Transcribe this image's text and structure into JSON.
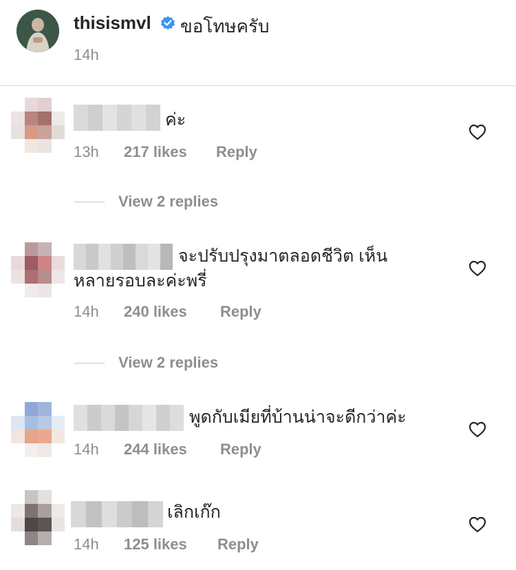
{
  "post": {
    "username": "thisismvl",
    "caption": "ขอโทษครับ",
    "time": "14h"
  },
  "comments": [
    {
      "text": "ค่ะ",
      "time": "13h",
      "likes": "217 likes",
      "reply": "Reply",
      "view_replies": "View 2 replies"
    },
    {
      "text": "จะปรับปรุงมาตลอดชีวิต เห็น\nหลายรอบละค่ะพรี่",
      "time": "14h",
      "likes": "240 likes",
      "reply": "Reply",
      "view_replies": "View 2 replies"
    },
    {
      "text": "พูดกับเมียที่บ้านน่าจะดีกว่าค่ะ",
      "time": "14h",
      "likes": "244 likes",
      "reply": "Reply"
    },
    {
      "text": "เลิกเก๊ก",
      "time": "14h",
      "likes": "125 likes",
      "reply": "Reply"
    }
  ],
  "icons": {
    "verified": "verified-badge-icon",
    "like": "heart-outline-icon"
  },
  "colors": {
    "verified_blue": "#3897f0",
    "meta_gray": "#8e8e8e",
    "text": "#262626"
  }
}
